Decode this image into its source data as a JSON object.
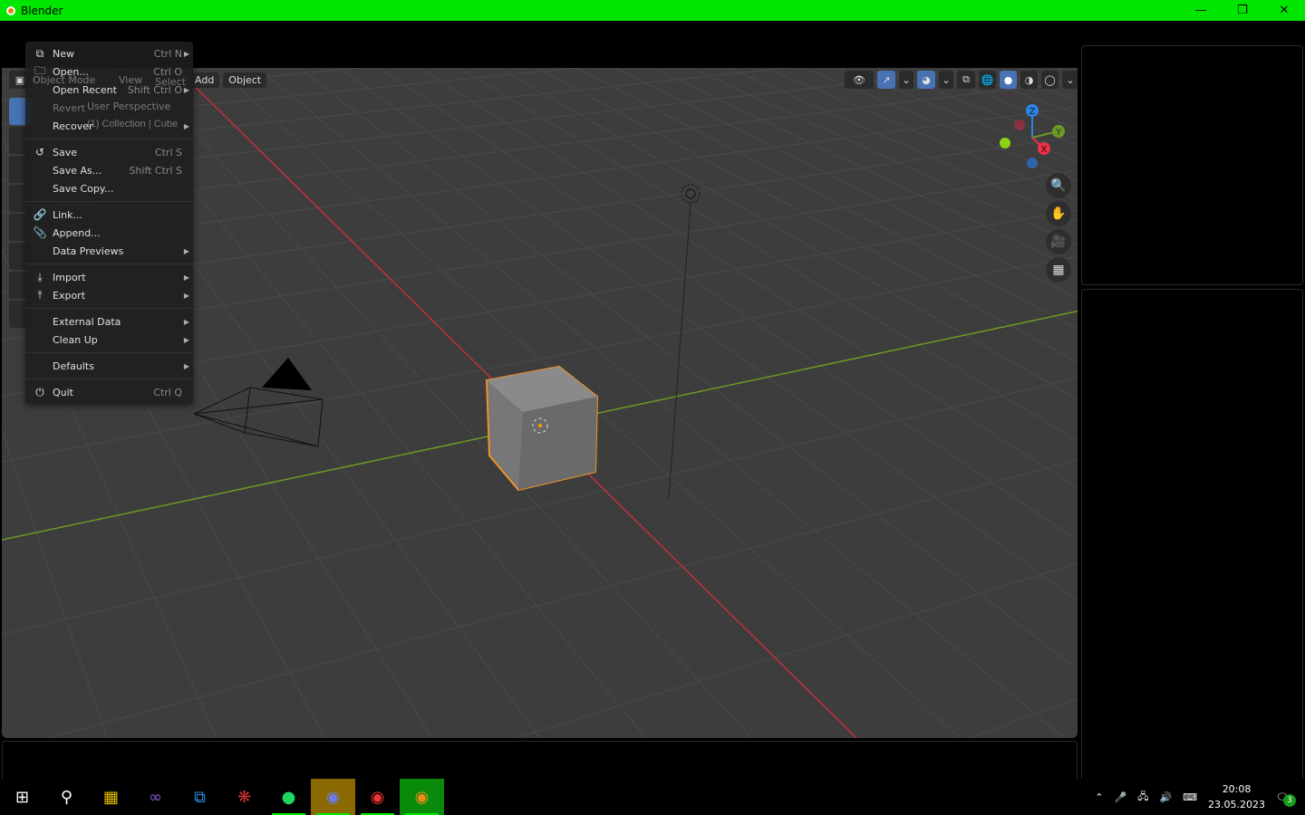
{
  "window": {
    "title": "Blender",
    "controls": [
      "minimize",
      "restore",
      "close"
    ]
  },
  "viewport": {
    "header": {
      "mode": "Object Mode",
      "menus": [
        "View",
        "Select",
        "Add",
        "Object"
      ]
    },
    "overlay": {
      "view_name": "User Perspective",
      "collection": "(1) Collection | Cube"
    },
    "shading_modes": [
      "wireframe",
      "solid",
      "material-preview",
      "rendered"
    ],
    "active_shading": "solid",
    "gizmo_axes": [
      "Z",
      "Y",
      "X"
    ],
    "nav_buttons": [
      "zoom",
      "pan",
      "camera",
      "perspective-toggle"
    ]
  },
  "file_menu": {
    "items": [
      {
        "label": "New",
        "shortcut": "Ctrl N",
        "submenu": true,
        "icon": "new-file-icon"
      },
      {
        "label": "Open...",
        "shortcut": "Ctrl O",
        "icon": "folder-icon"
      },
      {
        "label": "Open Recent",
        "shortcut": "Shift Ctrl O",
        "submenu": true
      },
      {
        "label": "Revert",
        "disabled": true
      },
      {
        "label": "Recover",
        "submenu": true
      },
      {
        "sep": true
      },
      {
        "label": "Save",
        "shortcut": "Ctrl S",
        "icon": "save-icon"
      },
      {
        "label": "Save As...",
        "shortcut": "Shift Ctrl S"
      },
      {
        "label": "Save Copy..."
      },
      {
        "sep": true
      },
      {
        "label": "Link...",
        "icon": "link-icon"
      },
      {
        "label": "Append...",
        "icon": "paperclip-icon"
      },
      {
        "label": "Data Previews",
        "submenu": true
      },
      {
        "sep": true
      },
      {
        "label": "Import",
        "submenu": true,
        "icon": "import-icon"
      },
      {
        "label": "Export",
        "submenu": true,
        "icon": "export-icon"
      },
      {
        "sep": true
      },
      {
        "label": "External Data",
        "submenu": true
      },
      {
        "label": "Clean Up",
        "submenu": true
      },
      {
        "sep": true
      },
      {
        "label": "Defaults",
        "submenu": true
      },
      {
        "sep": true
      },
      {
        "label": "Quit",
        "shortcut": "Ctrl Q",
        "icon": "power-icon"
      }
    ]
  },
  "taskbar": {
    "apps": [
      "start",
      "search",
      "app-1",
      "visual-studio",
      "vscode",
      "app-4",
      "spotify",
      "discord",
      "chrome",
      "blender"
    ],
    "clock": {
      "time": "20:08",
      "date": "23.05.2023"
    },
    "notification_count": "3"
  },
  "colors": {
    "titlebar": "#00e600",
    "selection": "#f0922a",
    "x_axis": "#c0303a",
    "y_axis": "#6c9a22",
    "active_button": "#4772b3"
  }
}
